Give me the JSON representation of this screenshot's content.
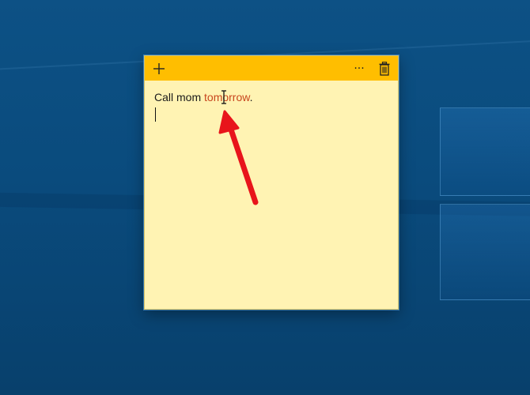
{
  "note": {
    "text_before": "Call mom ",
    "text_highlight": "tomorrow",
    "text_after": ".",
    "header_color": "#ffbe00",
    "body_color": "#fff3b3",
    "misspelled_color": "#c8461e"
  },
  "toolbar": {
    "add_icon": "plus-icon",
    "menu_label": "···",
    "delete_icon": "trash-icon"
  },
  "annotation": {
    "arrow_color": "#e8141b"
  }
}
